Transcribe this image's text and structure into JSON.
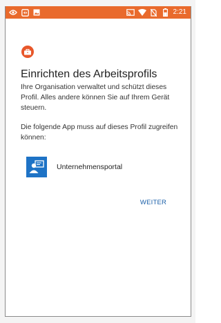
{
  "status_bar": {
    "time": "2:21",
    "icons": [
      "eye-icon",
      "rotate-icon",
      "image-icon",
      "cast-icon",
      "wifi-icon",
      "no-sim-icon",
      "battery-icon"
    ]
  },
  "header": {
    "badge_icon": "briefcase-icon",
    "title": "Einrichten des Arbeitsprofils"
  },
  "body": {
    "description": "Ihre Organisation verwaltet und schützt dieses Profil. Alles andere können Sie auf Ihrem Gerät steuern.",
    "apps_intro": "Die folgende App muss auf dieses Profil zugreifen können:"
  },
  "app": {
    "icon": "company-portal-icon",
    "name": "Unternehmensportal"
  },
  "actions": {
    "next_label": "WEITER"
  },
  "colors": {
    "status_bar": "#e96a2c",
    "badge": "#e8572a",
    "app_icon": "#1e73c6",
    "button_text": "#1a5fa8"
  }
}
